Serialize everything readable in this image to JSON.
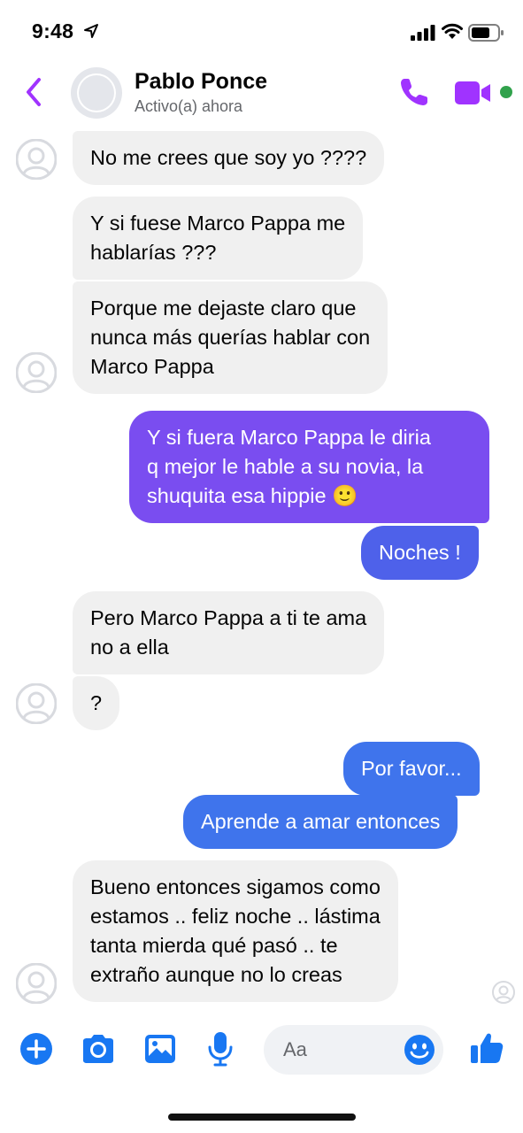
{
  "status_bar": {
    "time": "9:48"
  },
  "header": {
    "contact_name": "Pablo Ponce",
    "contact_status": "Activo(a) ahora",
    "accent_color": "#a033ff"
  },
  "messages": [
    {
      "direction": "incoming",
      "lines": [
        "No me crees que soy yo ????"
      ]
    },
    {
      "direction": "incoming",
      "lines": [
        "Y si fuese Marco Pappa me",
        "hablarías ???"
      ]
    },
    {
      "direction": "incoming",
      "lines": [
        "Porque me dejaste claro que",
        "nunca más querías hablar con",
        "Marco Pappa"
      ]
    },
    {
      "direction": "outgoing",
      "lines": [
        "Y si fuera Marco Pappa le diria",
        "q mejor le hable a su novia, la",
        "shuquita esa hippie 🙂"
      ]
    },
    {
      "direction": "outgoing",
      "lines": [
        "Noches !"
      ]
    },
    {
      "direction": "incoming",
      "lines": [
        "Pero Marco Pappa a ti te ama",
        "no a ella"
      ]
    },
    {
      "direction": "incoming",
      "lines": [
        "?"
      ]
    },
    {
      "direction": "outgoing",
      "lines": [
        "Por favor..."
      ]
    },
    {
      "direction": "outgoing",
      "lines": [
        "Aprende a amar entonces"
      ]
    },
    {
      "direction": "incoming",
      "lines": [
        "Bueno entonces sigamos como",
        "estamos .. feliz noche .. lástima",
        "tanta mierda qué pasó .. te",
        "extraño aunque no lo creas"
      ]
    }
  ],
  "composer": {
    "placeholder": "Aa",
    "icons": [
      "plus-icon",
      "camera-icon",
      "image-icon",
      "microphone-icon",
      "emoji-icon",
      "thumbs-up-icon"
    ],
    "icon_color": "#1877f2"
  },
  "colors": {
    "incoming_bubble": "#f0f0f0",
    "outgoing_purple": "#7a4df0",
    "outgoing_indigo": "#4e61ea",
    "outgoing_blue": "#3f74ec",
    "online": "#31a24c"
  }
}
